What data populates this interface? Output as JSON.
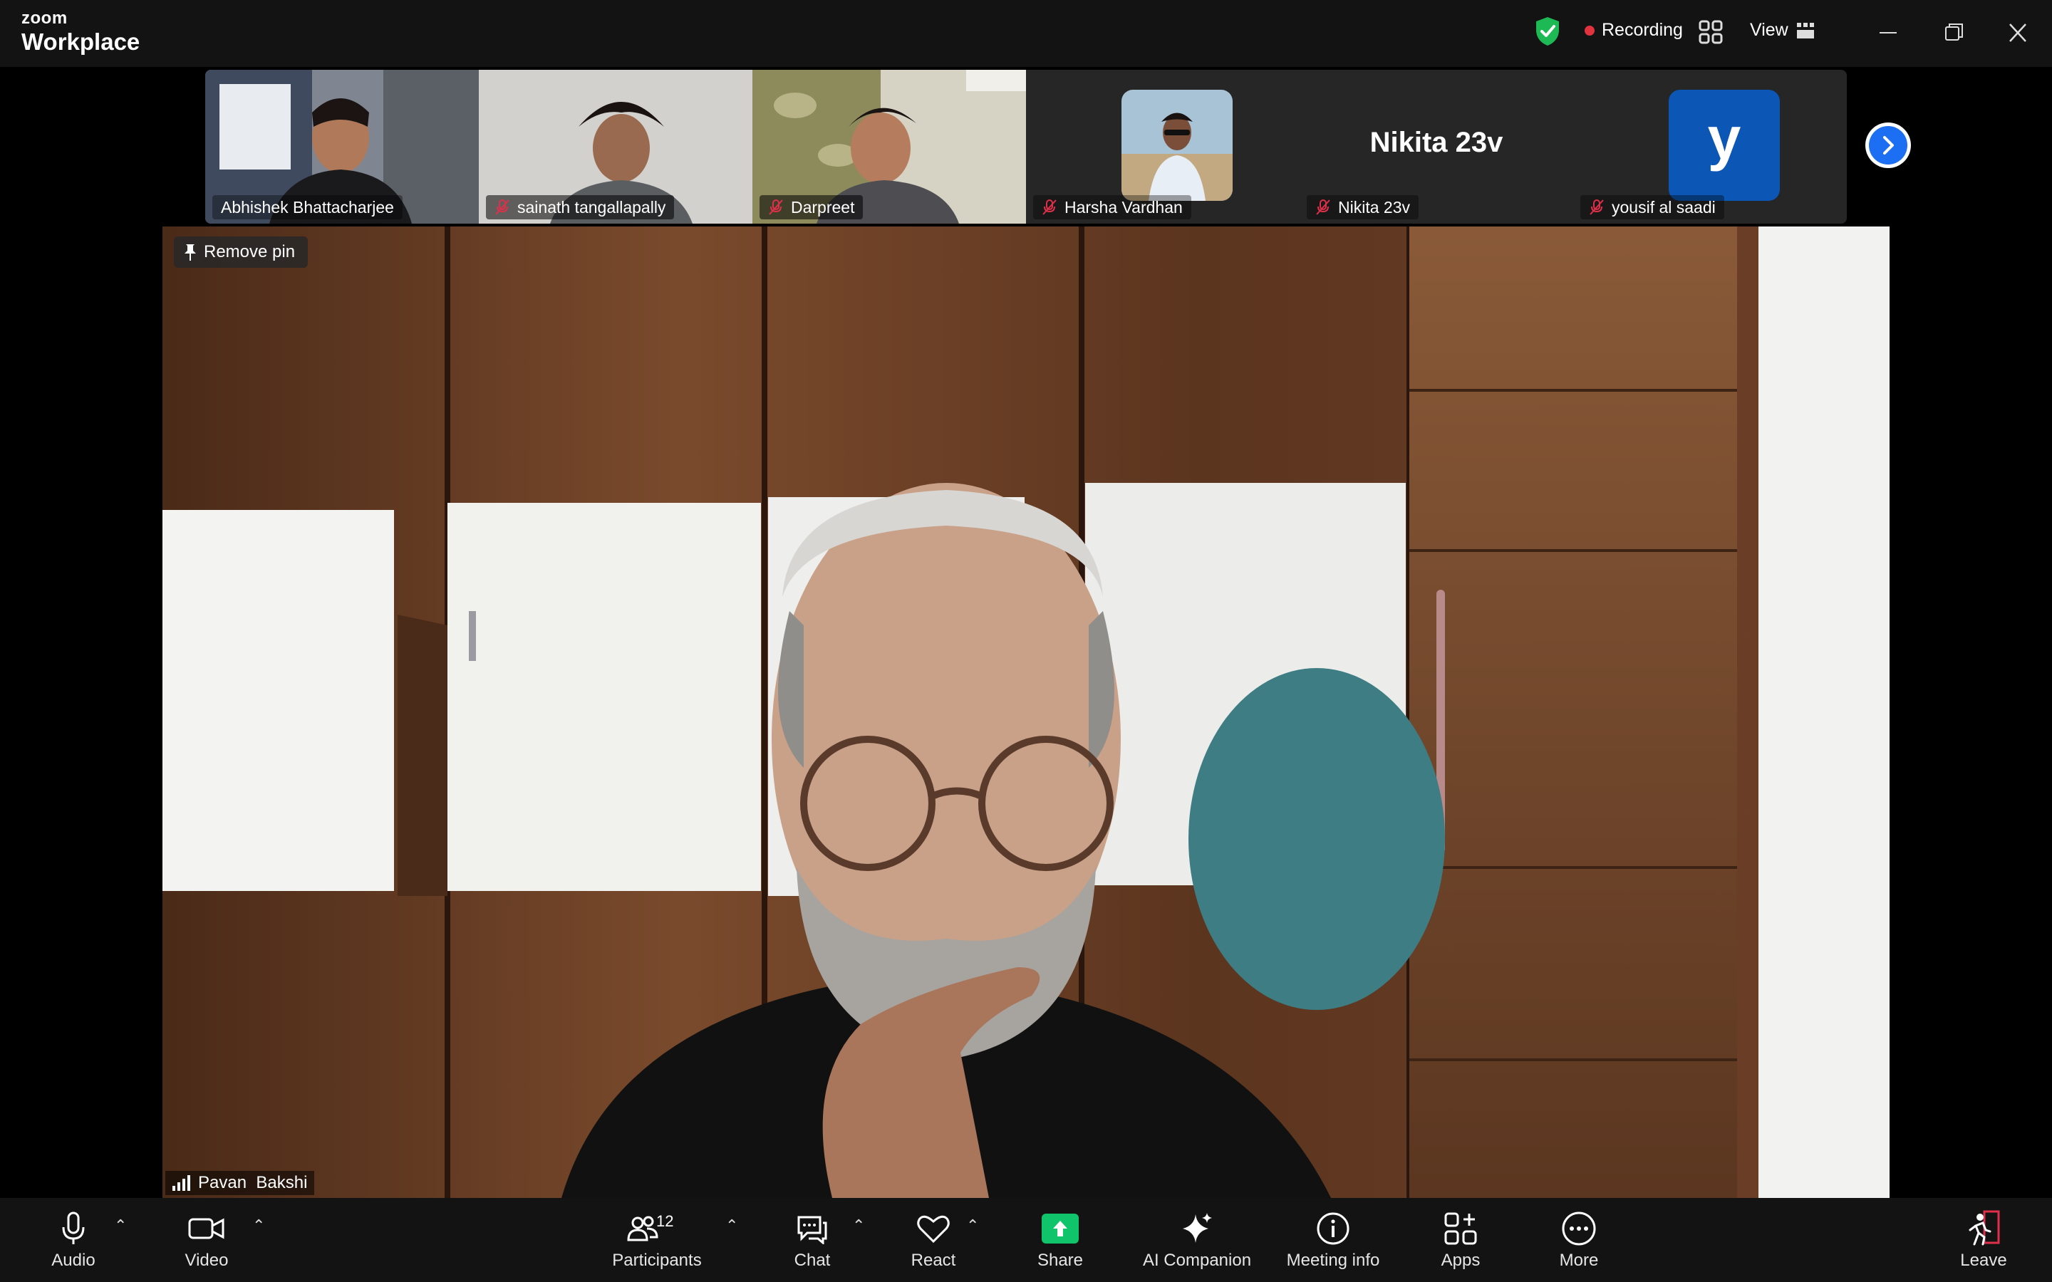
{
  "app": {
    "brand_small": "zoom",
    "brand_big": "Workplace"
  },
  "titlebar": {
    "recording_label": "Recording",
    "view_label": "View"
  },
  "participants_strip": [
    {
      "name": "Abhishek Bhattacharjee",
      "muted": false
    },
    {
      "name": "sainath tangallapally",
      "muted": true
    },
    {
      "name": "Darpreet",
      "muted": true
    },
    {
      "name": "Harsha Vardhan",
      "muted": true
    },
    {
      "name": "Nikita 23v",
      "muted": true,
      "display_name": "Nikita 23v"
    },
    {
      "name": "yousif al saadi",
      "muted": true,
      "avatar_letter": "y"
    }
  ],
  "main_video": {
    "pin_label": "Remove pin",
    "speaker_name": "Pavan  Bakshi"
  },
  "toolbar": {
    "audio": "Audio",
    "video": "Video",
    "participants": "Participants",
    "participants_count": "12",
    "chat": "Chat",
    "react": "React",
    "share": "Share",
    "ai_companion": "AI Companion",
    "meeting_info": "Meeting info",
    "apps": "Apps",
    "more": "More",
    "leave": "Leave"
  },
  "colors": {
    "recording": "#e0333f",
    "share": "#0fc46b",
    "leave": "#e02f4a",
    "next_button": "#1c6ef2",
    "avatar_bg": "#0c56b5",
    "shield": "#1db954"
  }
}
